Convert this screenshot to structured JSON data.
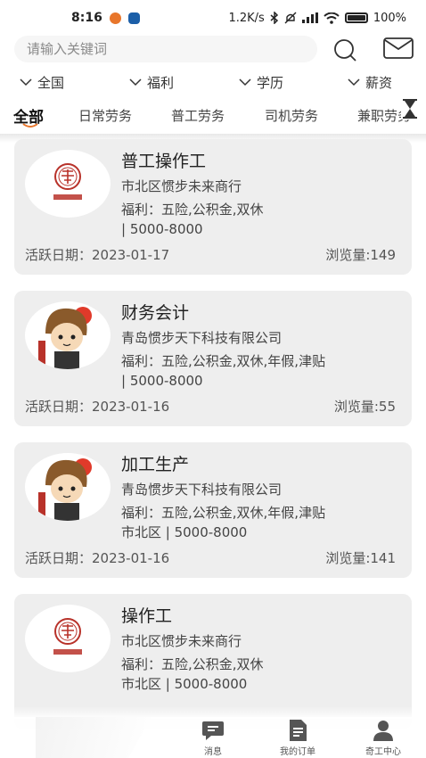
{
  "status_bar": {
    "time": "8:16",
    "network_speed": "1.2K/s",
    "battery": "100%",
    "colors": {
      "app1": "#e8762b",
      "app2": "#1c5fa8"
    }
  },
  "search": {
    "placeholder": "请输入关键词",
    "icons": [
      "search-icon",
      "mail-icon"
    ]
  },
  "filters": [
    {
      "label": "全国"
    },
    {
      "label": "福利"
    },
    {
      "label": "学历"
    },
    {
      "label": "薪资"
    }
  ],
  "tabs": [
    {
      "label": "全部",
      "active": true
    },
    {
      "label": "日常劳务"
    },
    {
      "label": "普工劳务"
    },
    {
      "label": "司机劳务"
    },
    {
      "label": "兼职劳务"
    }
  ],
  "accent_color": "#e8762b",
  "jobs": [
    {
      "logo": "seal-logo",
      "title": "普工操作工",
      "company": "市北区惯步未来商行",
      "welfare_line1": "福利：五险,公积金,双休",
      "welfare_line2": "| 5000-8000",
      "active_date": "活跃日期：2023-01-17",
      "views": "浏览量:149"
    },
    {
      "logo": "cartoon-avatar",
      "title": "财务会计",
      "company": "青岛惯步天下科技有限公司",
      "welfare_line1": "福利：五险,公积金,双休,年假,津贴",
      "welfare_line2": "| 5000-8000",
      "active_date": "活跃日期：2023-01-16",
      "views": "浏览量:55"
    },
    {
      "logo": "cartoon-avatar",
      "title": "加工生产",
      "company": "青岛惯步天下科技有限公司",
      "welfare_line1": "福利：五险,公积金,双休,年假,津贴",
      "welfare_line2": "市北区 | 5000-8000",
      "active_date": "活跃日期：2023-01-16",
      "views": "浏览量:141"
    },
    {
      "logo": "seal-logo",
      "title": "操作工",
      "company": "市北区惯步未来商行",
      "welfare_line1": "福利：五险,公积金,双休",
      "welfare_line2": "市北区 | 5000-8000",
      "active_date": "",
      "views": ""
    }
  ],
  "bottom_nav": [
    {
      "label": "消息",
      "icon": "chat-icon"
    },
    {
      "label": "我的订单",
      "icon": "document-icon"
    },
    {
      "label": "奇工中心",
      "icon": "user-icon"
    }
  ]
}
